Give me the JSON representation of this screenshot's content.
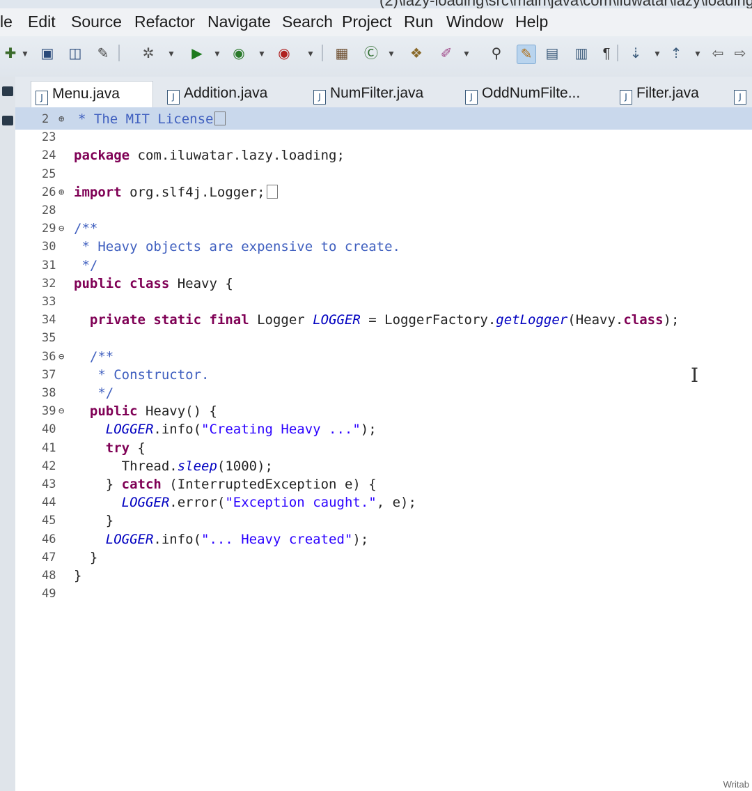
{
  "window": {
    "title_fragment": "(2)\\lazy-loading\\src\\main\\java\\com\\iluwatar\\lazy\\loading\\"
  },
  "menubar": {
    "items": [
      "le",
      "Edit",
      "Source",
      "Refactor",
      "Navigate",
      "Search",
      "Project",
      "Run",
      "Window",
      "Help"
    ]
  },
  "tabs": [
    {
      "label": "Menu.java",
      "active": true
    },
    {
      "label": "Addition.java",
      "active": false
    },
    {
      "label": "NumFilter.java",
      "active": false
    },
    {
      "label": "OddNumFilte...",
      "active": false
    },
    {
      "label": "Filter.java",
      "active": false
    }
  ],
  "editor": {
    "lines": [
      {
        "n": "2",
        "fold": "⊕",
        "segments": [
          {
            "t": "cm",
            "v": "* The MIT License"
          }
        ],
        "folded": true
      },
      {
        "n": "23",
        "segments": []
      },
      {
        "n": "24",
        "segments": [
          {
            "t": "kw",
            "v": "package"
          },
          {
            "t": "",
            "v": " com.iluwatar.lazy.loading;"
          }
        ]
      },
      {
        "n": "25",
        "segments": []
      },
      {
        "n": "26",
        "fold": "⊕",
        "segments": [
          {
            "t": "kw",
            "v": "import"
          },
          {
            "t": "",
            "v": " org.slf4j.Logger;"
          }
        ],
        "folded": true
      },
      {
        "n": "28",
        "segments": []
      },
      {
        "n": "29",
        "fold": "⊖",
        "segments": [
          {
            "t": "cm",
            "v": "/**"
          }
        ]
      },
      {
        "n": "30",
        "segments": [
          {
            "t": "cm",
            "v": " * Heavy objects are expensive to create."
          }
        ]
      },
      {
        "n": "31",
        "segments": [
          {
            "t": "cm",
            "v": " */"
          }
        ]
      },
      {
        "n": "32",
        "segments": [
          {
            "t": "kw",
            "v": "public class"
          },
          {
            "t": "",
            "v": " Heavy {"
          }
        ]
      },
      {
        "n": "33",
        "segments": []
      },
      {
        "n": "34",
        "segments": [
          {
            "t": "kw",
            "v": "  private static final"
          },
          {
            "t": "",
            "v": " Logger "
          },
          {
            "t": "fld",
            "v": "LOGGER"
          },
          {
            "t": "",
            "v": " = LoggerFactory."
          },
          {
            "t": "fld",
            "v": "getLogger"
          },
          {
            "t": "",
            "v": "(Heavy."
          },
          {
            "t": "kw",
            "v": "class"
          },
          {
            "t": "",
            "v": ");"
          }
        ]
      },
      {
        "n": "35",
        "segments": []
      },
      {
        "n": "36",
        "fold": "⊖",
        "segments": [
          {
            "t": "cm",
            "v": "  /**"
          }
        ]
      },
      {
        "n": "37",
        "segments": [
          {
            "t": "cm",
            "v": "   * Constructor."
          }
        ]
      },
      {
        "n": "38",
        "segments": [
          {
            "t": "cm",
            "v": "   */"
          }
        ]
      },
      {
        "n": "39",
        "fold": "⊖",
        "segments": [
          {
            "t": "kw",
            "v": "  public"
          },
          {
            "t": "",
            "v": " Heavy() {"
          }
        ]
      },
      {
        "n": "40",
        "segments": [
          {
            "t": "fld",
            "v": "    LOGGER"
          },
          {
            "t": "",
            "v": ".info("
          },
          {
            "t": "str",
            "v": "\"Creating Heavy ...\""
          },
          {
            "t": "",
            "v": ");"
          }
        ]
      },
      {
        "n": "41",
        "segments": [
          {
            "t": "kw",
            "v": "    try"
          },
          {
            "t": "",
            "v": " {"
          }
        ]
      },
      {
        "n": "42",
        "segments": [
          {
            "t": "",
            "v": "      Thread."
          },
          {
            "t": "fld",
            "v": "sleep"
          },
          {
            "t": "",
            "v": "(1000);"
          }
        ]
      },
      {
        "n": "43",
        "segments": [
          {
            "t": "",
            "v": "    } "
          },
          {
            "t": "kw",
            "v": "catch"
          },
          {
            "t": "",
            "v": " (InterruptedException e) {"
          }
        ]
      },
      {
        "n": "44",
        "segments": [
          {
            "t": "fld",
            "v": "      LOGGER"
          },
          {
            "t": "",
            "v": ".error("
          },
          {
            "t": "str",
            "v": "\"Exception caught.\""
          },
          {
            "t": "",
            "v": ", e);"
          }
        ]
      },
      {
        "n": "45",
        "segments": [
          {
            "t": "",
            "v": "    }"
          }
        ]
      },
      {
        "n": "46",
        "segments": [
          {
            "t": "fld",
            "v": "    LOGGER"
          },
          {
            "t": "",
            "v": ".info("
          },
          {
            "t": "str",
            "v": "\"... Heavy created\""
          },
          {
            "t": "",
            "v": ");"
          }
        ]
      },
      {
        "n": "47",
        "segments": [
          {
            "t": "",
            "v": "  }"
          }
        ]
      },
      {
        "n": "48",
        "segments": [
          {
            "t": "",
            "v": "}"
          }
        ]
      },
      {
        "n": "49",
        "segments": []
      }
    ]
  },
  "status": {
    "text": "Writab"
  }
}
